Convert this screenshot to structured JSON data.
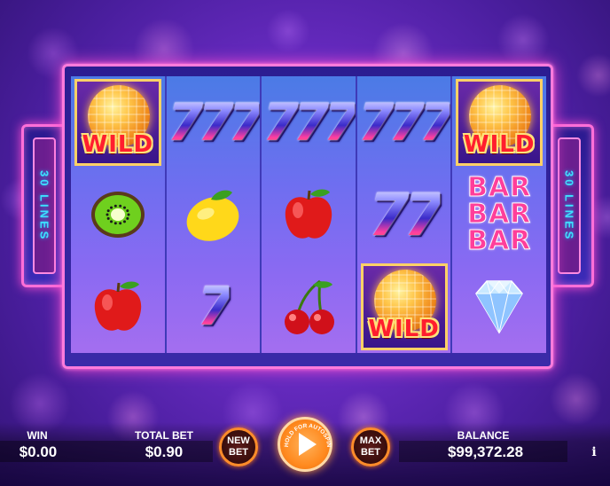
{
  "paylines": {
    "text": "30 LINES"
  },
  "reels": [
    [
      "wild",
      "kiwi",
      "apple"
    ],
    [
      "sevens3",
      "lemon",
      "seven1"
    ],
    [
      "sevens3",
      "apple",
      "cherry"
    ],
    [
      "sevens3",
      "sevens2",
      "wild"
    ],
    [
      "wild",
      "bar3",
      "diamond"
    ]
  ],
  "symbols": {
    "wild_label": "WILD",
    "sevens3": "777",
    "sevens2": "77",
    "seven1": "7",
    "bar": "BAR"
  },
  "bottom": {
    "win_label": "WIN",
    "win_value": "$0.00",
    "total_bet_label": "TOTAL BET",
    "total_bet_value": "$0.90",
    "new_bet_label": "NEW BET",
    "autospin_hint": "HOLD FOR AUTOSPIN",
    "max_bet_label": "MAX BET",
    "balance_label": "BALANCE",
    "balance_value": "$99,372.28",
    "info_label": "i"
  },
  "colors": {
    "frame_glow": "#ff4fd0",
    "lines_text": "#3ce3ff",
    "spin_button": "#ff8a1f",
    "wild_text": "#ff1e2e"
  }
}
